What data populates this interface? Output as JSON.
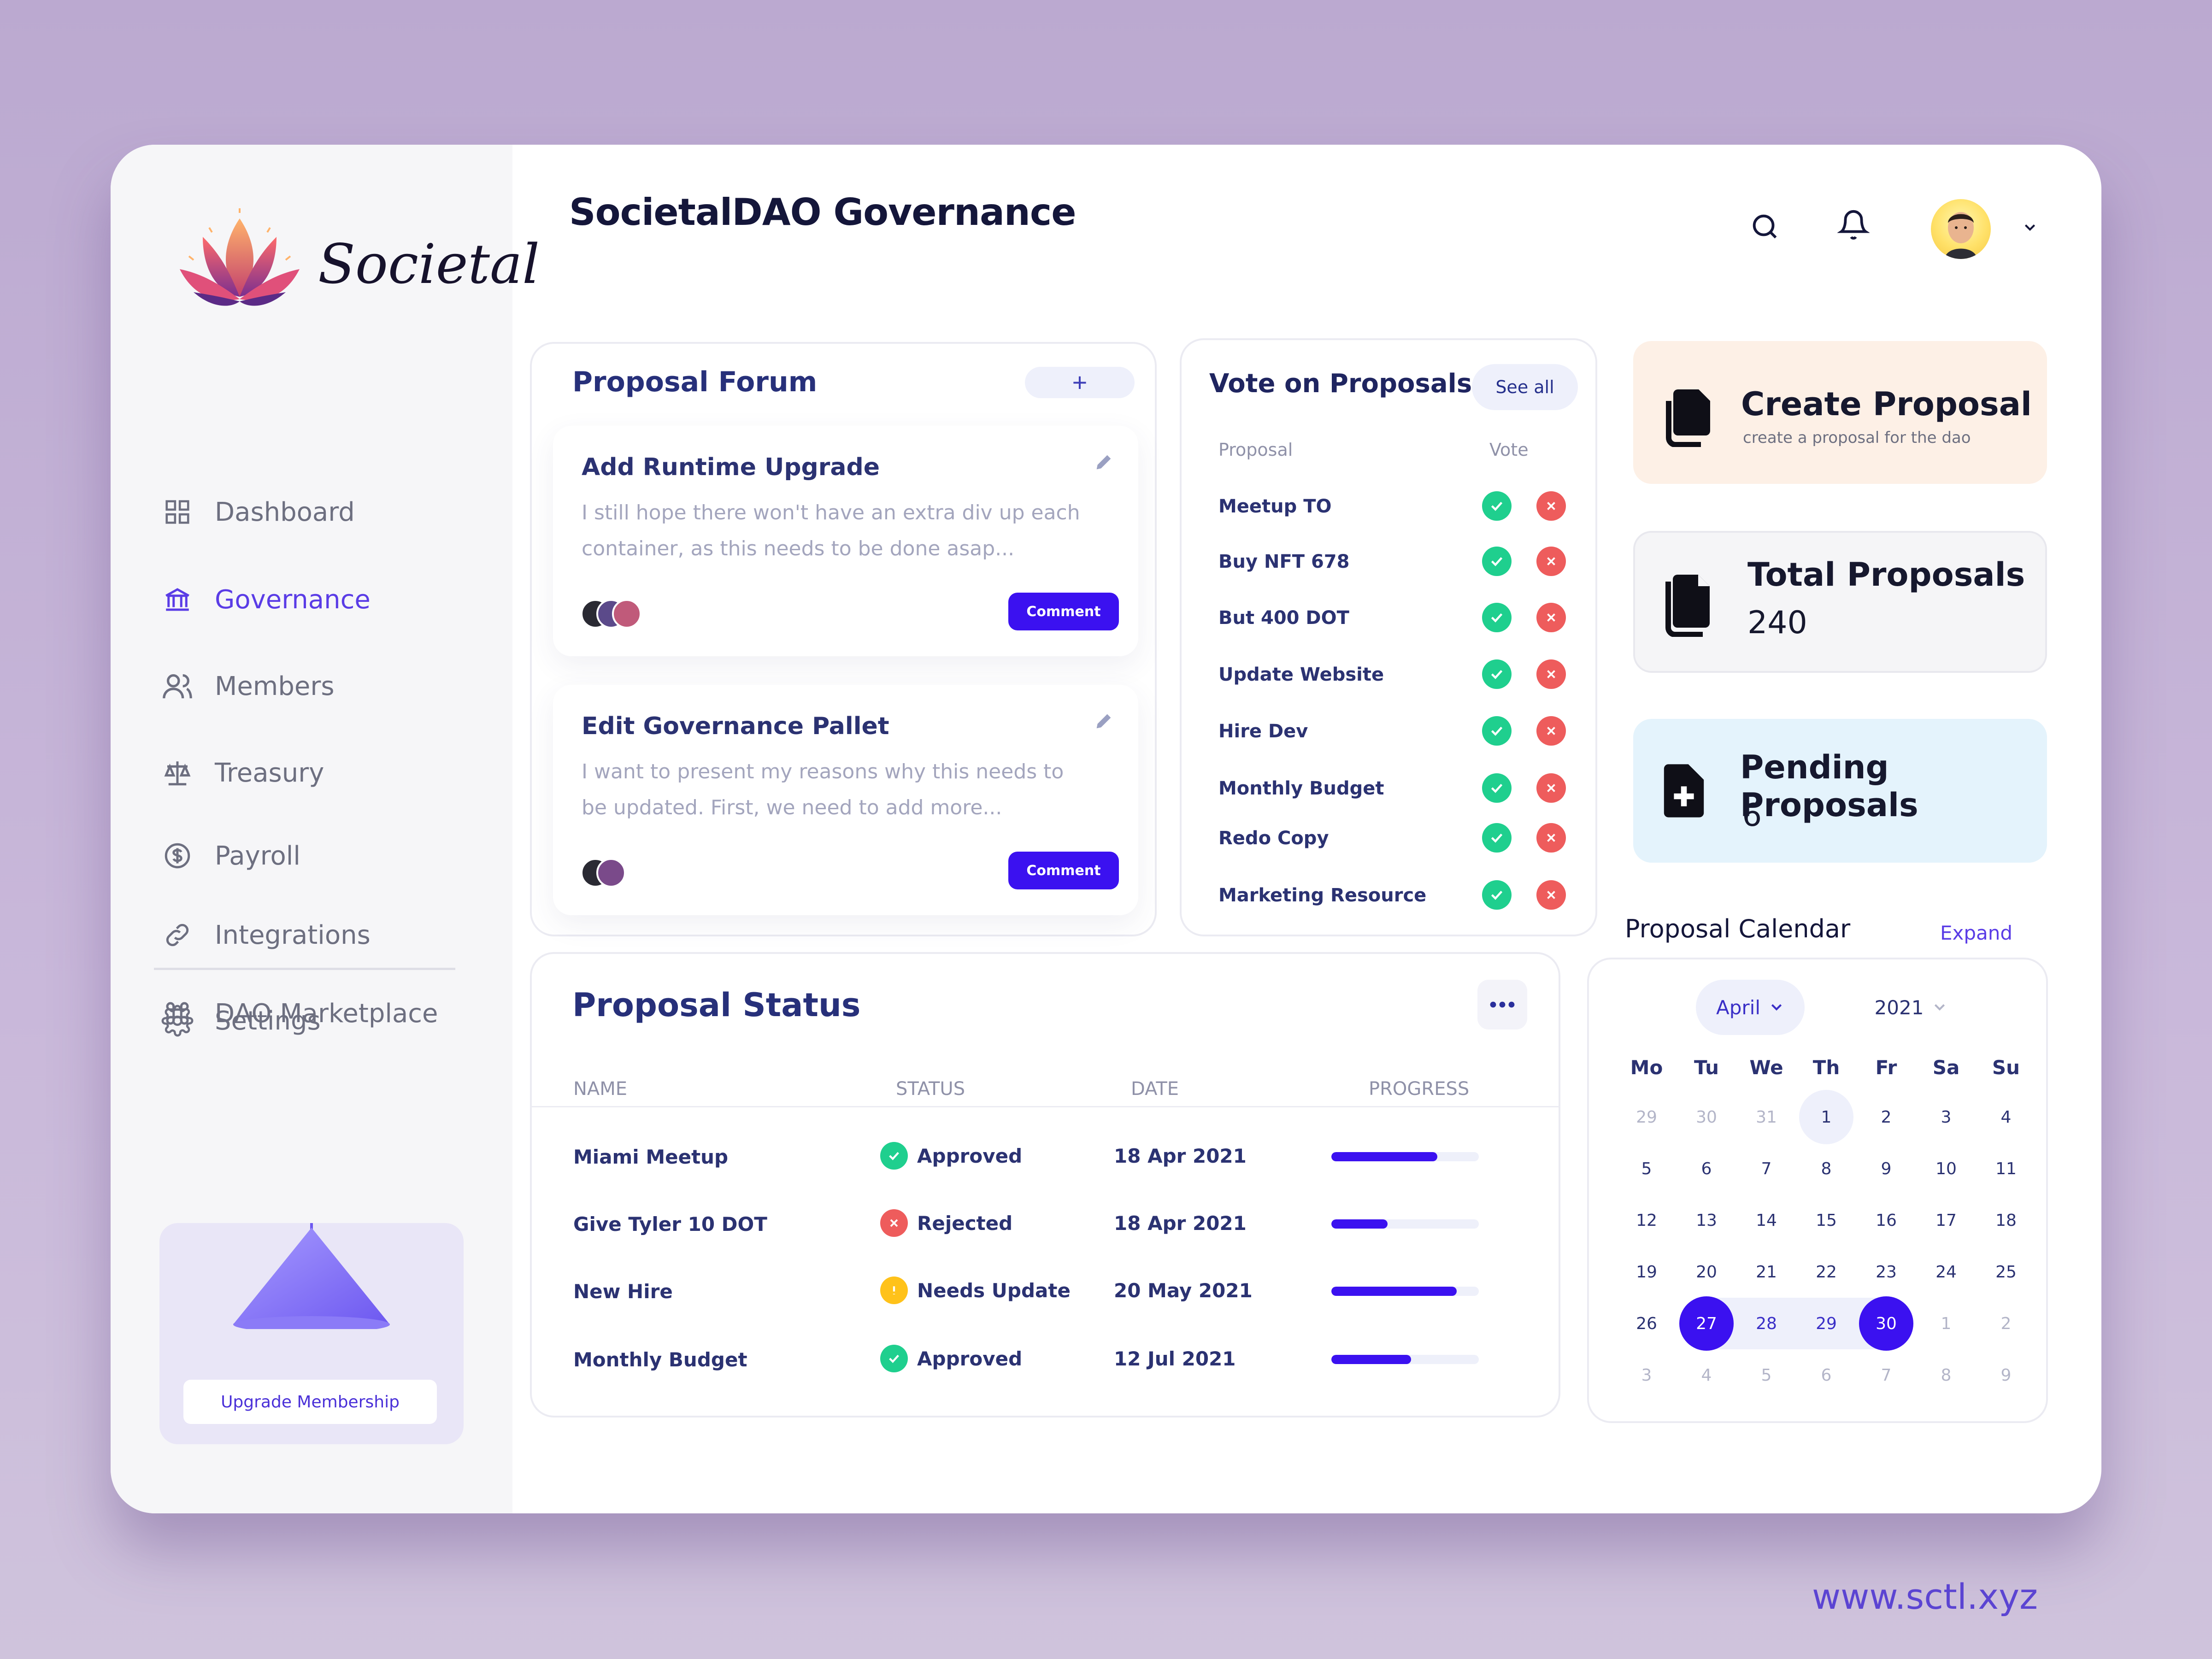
{
  "app": {
    "brand": "Societal",
    "page_title": "SocietalDAO Governance",
    "footer_url": "www.sctl.xyz"
  },
  "sidebar": {
    "items": [
      {
        "label": "Dashboard",
        "icon": "grid-icon",
        "active": false
      },
      {
        "label": "Governance",
        "icon": "bank-icon",
        "active": true
      },
      {
        "label": "Members",
        "icon": "users-icon",
        "active": false
      },
      {
        "label": "Treasury",
        "icon": "scale-icon",
        "active": false
      },
      {
        "label": "Payroll",
        "icon": "dollar-circle-icon",
        "active": false
      },
      {
        "label": "Integrations",
        "icon": "link-icon",
        "active": false
      },
      {
        "label": "DAO Marketplace",
        "icon": "command-icon",
        "active": false
      }
    ],
    "settings_label": "Settings",
    "upgrade_label": "Upgrade Membership"
  },
  "forum": {
    "title": "Proposal Forum",
    "add_label": "+",
    "posts": [
      {
        "title": "Add Runtime Upgrade",
        "text": "I still hope there won't have an extra div up each container, as this needs to be done asap...",
        "comment_label": "Comment"
      },
      {
        "title": "Edit Governance Pallet",
        "text": "I want to present my reasons why this needs to be updated. First, we need to add more...",
        "comment_label": "Comment"
      }
    ]
  },
  "vote": {
    "title": "Vote on Proposals",
    "see_all": "See all",
    "col_proposal": "Proposal",
    "col_vote": "Vote",
    "rows": [
      "Meetup TO",
      "Buy NFT 678",
      "But 400 DOT",
      "Update Website",
      "Hire Dev",
      "Monthly Budget",
      "Redo Copy",
      "Marketing Resource"
    ]
  },
  "stats": {
    "create": {
      "title": "Create Proposal",
      "subtitle": "create a proposal for the dao"
    },
    "total": {
      "title": "Total Proposals",
      "value": "240"
    },
    "pending": {
      "title": "Pending Proposals",
      "value": "6"
    }
  },
  "status": {
    "title": "Proposal Status",
    "columns": {
      "name": "NAME",
      "status": "STATUS",
      "date": "DATE",
      "progress": "PROGRESS"
    },
    "rows": [
      {
        "name": "Miami Meetup",
        "status": "Approved",
        "kind": "approved",
        "date": "18 Apr 2021",
        "progress": 0.72
      },
      {
        "name": "Give Tyler 10 DOT",
        "status": "Rejected",
        "kind": "rejected",
        "date": "18 Apr 2021",
        "progress": 0.38
      },
      {
        "name": "New Hire",
        "status": "Needs Update",
        "kind": "update",
        "date": "20 May 2021",
        "progress": 0.85
      },
      {
        "name": "Monthly Budget",
        "status": "Approved",
        "kind": "approved",
        "date": "12 Jul 2021",
        "progress": 0.54
      }
    ],
    "colors": {
      "approved": "#1fcf8e",
      "rejected": "#ee5c5c",
      "update": "#ffc21a"
    }
  },
  "calendar": {
    "title": "Proposal Calendar",
    "expand": "Expand",
    "month": "April",
    "year": "2021",
    "weekdays": [
      "Mo",
      "Tu",
      "We",
      "Th",
      "Fr",
      "Sa",
      "Su"
    ],
    "weeks": [
      [
        {
          "d": "29",
          "m": 1
        },
        {
          "d": "30",
          "m": 1
        },
        {
          "d": "31",
          "m": 1
        },
        {
          "d": "1",
          "m": 0,
          "today": 1
        },
        {
          "d": "2",
          "m": 0
        },
        {
          "d": "3",
          "m": 0
        },
        {
          "d": "4",
          "m": 0
        }
      ],
      [
        {
          "d": "5",
          "m": 0
        },
        {
          "d": "6",
          "m": 0
        },
        {
          "d": "7",
          "m": 0
        },
        {
          "d": "8",
          "m": 0
        },
        {
          "d": "9",
          "m": 0
        },
        {
          "d": "10",
          "m": 0
        },
        {
          "d": "11",
          "m": 0
        }
      ],
      [
        {
          "d": "12",
          "m": 0
        },
        {
          "d": "13",
          "m": 0
        },
        {
          "d": "14",
          "m": 0
        },
        {
          "d": "15",
          "m": 0
        },
        {
          "d": "16",
          "m": 0
        },
        {
          "d": "17",
          "m": 0
        },
        {
          "d": "18",
          "m": 0
        }
      ],
      [
        {
          "d": "19",
          "m": 0
        },
        {
          "d": "20",
          "m": 0
        },
        {
          "d": "21",
          "m": 0
        },
        {
          "d": "22",
          "m": 0
        },
        {
          "d": "23",
          "m": 0
        },
        {
          "d": "24",
          "m": 0
        },
        {
          "d": "25",
          "m": 0
        }
      ],
      [
        {
          "d": "26",
          "m": 0
        },
        {
          "d": "27",
          "m": 0,
          "sel": 1
        },
        {
          "d": "28",
          "m": 0,
          "range": 1
        },
        {
          "d": "29",
          "m": 0,
          "range": 1
        },
        {
          "d": "30",
          "m": 0,
          "sel": 1
        },
        {
          "d": "1",
          "m": 1
        },
        {
          "d": "2",
          "m": 1
        }
      ],
      [
        {
          "d": "3",
          "m": 1
        },
        {
          "d": "4",
          "m": 1
        },
        {
          "d": "5",
          "m": 1
        },
        {
          "d": "6",
          "m": 1
        },
        {
          "d": "7",
          "m": 1
        },
        {
          "d": "8",
          "m": 1
        },
        {
          "d": "9",
          "m": 1
        }
      ]
    ]
  }
}
